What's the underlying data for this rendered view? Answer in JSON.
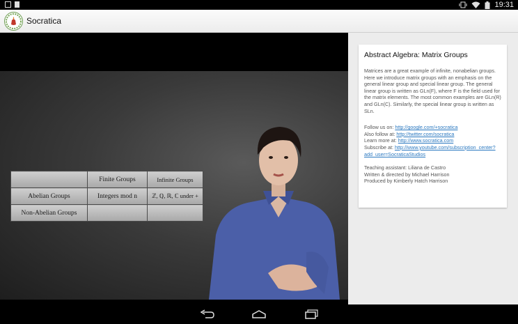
{
  "status": {
    "time": "19:31"
  },
  "app": {
    "title": "Socratica"
  },
  "slide": {
    "rows": [
      [
        "",
        "Finite Groups",
        "Infinite Groups"
      ],
      [
        "Abelian Groups",
        "Integers mod n",
        "ℤ, ℚ, ℝ, ℂ under +"
      ],
      [
        "Non-Abelian Groups",
        "",
        ""
      ]
    ]
  },
  "video_info": {
    "title": "Abstract Algebra: Matrix Groups",
    "description": "Matrices are a great example of infinite, nonabelian groups.  Here we introduce matrix groups with an emphasis on the general linear group and special linear group.  The general linear group is written as GLn(F), where F is the field used for the matrix elements.  The most common examples are GLn(R) and GLn(C).  Similarly, the special linear group is written as SLn.",
    "links": [
      {
        "label": "Follow us on: ",
        "url": "http://google.com/+socratica"
      },
      {
        "label": "Also follow at:  ",
        "url": "http://twitter.com/socratica"
      },
      {
        "label": "Learn more at: ",
        "url": "http://www.socratica.com"
      },
      {
        "label": "Subscribe at: ",
        "url": "http://www.youtube.com/subscription_center?add_user=SocraticaStudios"
      }
    ],
    "credits": [
      "Teaching assistant:  Liliana de Castro",
      "Written & directed by Michael Harrison",
      "Produced by Kimberly Hatch Harrison"
    ]
  }
}
